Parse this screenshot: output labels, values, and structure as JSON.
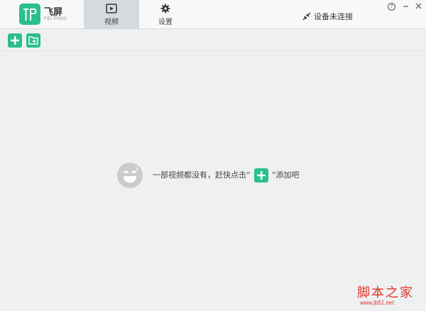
{
  "app": {
    "brand_cn": "飞屏",
    "brand_en": "FEI PING"
  },
  "tabs": [
    {
      "label": "视频",
      "icon": "video-icon",
      "active": true
    },
    {
      "label": "设置",
      "icon": "gear-icon",
      "active": false
    }
  ],
  "connection": {
    "status": "设备未连接",
    "icon": "unplugged-icon"
  },
  "window_controls": {
    "help": "?"
  },
  "toolbar": {
    "buttons": [
      {
        "icon": "add-icon"
      },
      {
        "icon": "add-folder-icon"
      }
    ]
  },
  "empty_state": {
    "text_before": "一部视频都没有，赶快点击“",
    "text_after": "”添加吧",
    "icon": "smiley-icon"
  },
  "watermark": {
    "cn": "脚本之家",
    "url": "www.jb51.net"
  },
  "colors": {
    "accent": "#2bbf8c",
    "background": "#eef0f1",
    "titlebar": "#f7f8f8",
    "active_tab": "#d7dadc"
  }
}
